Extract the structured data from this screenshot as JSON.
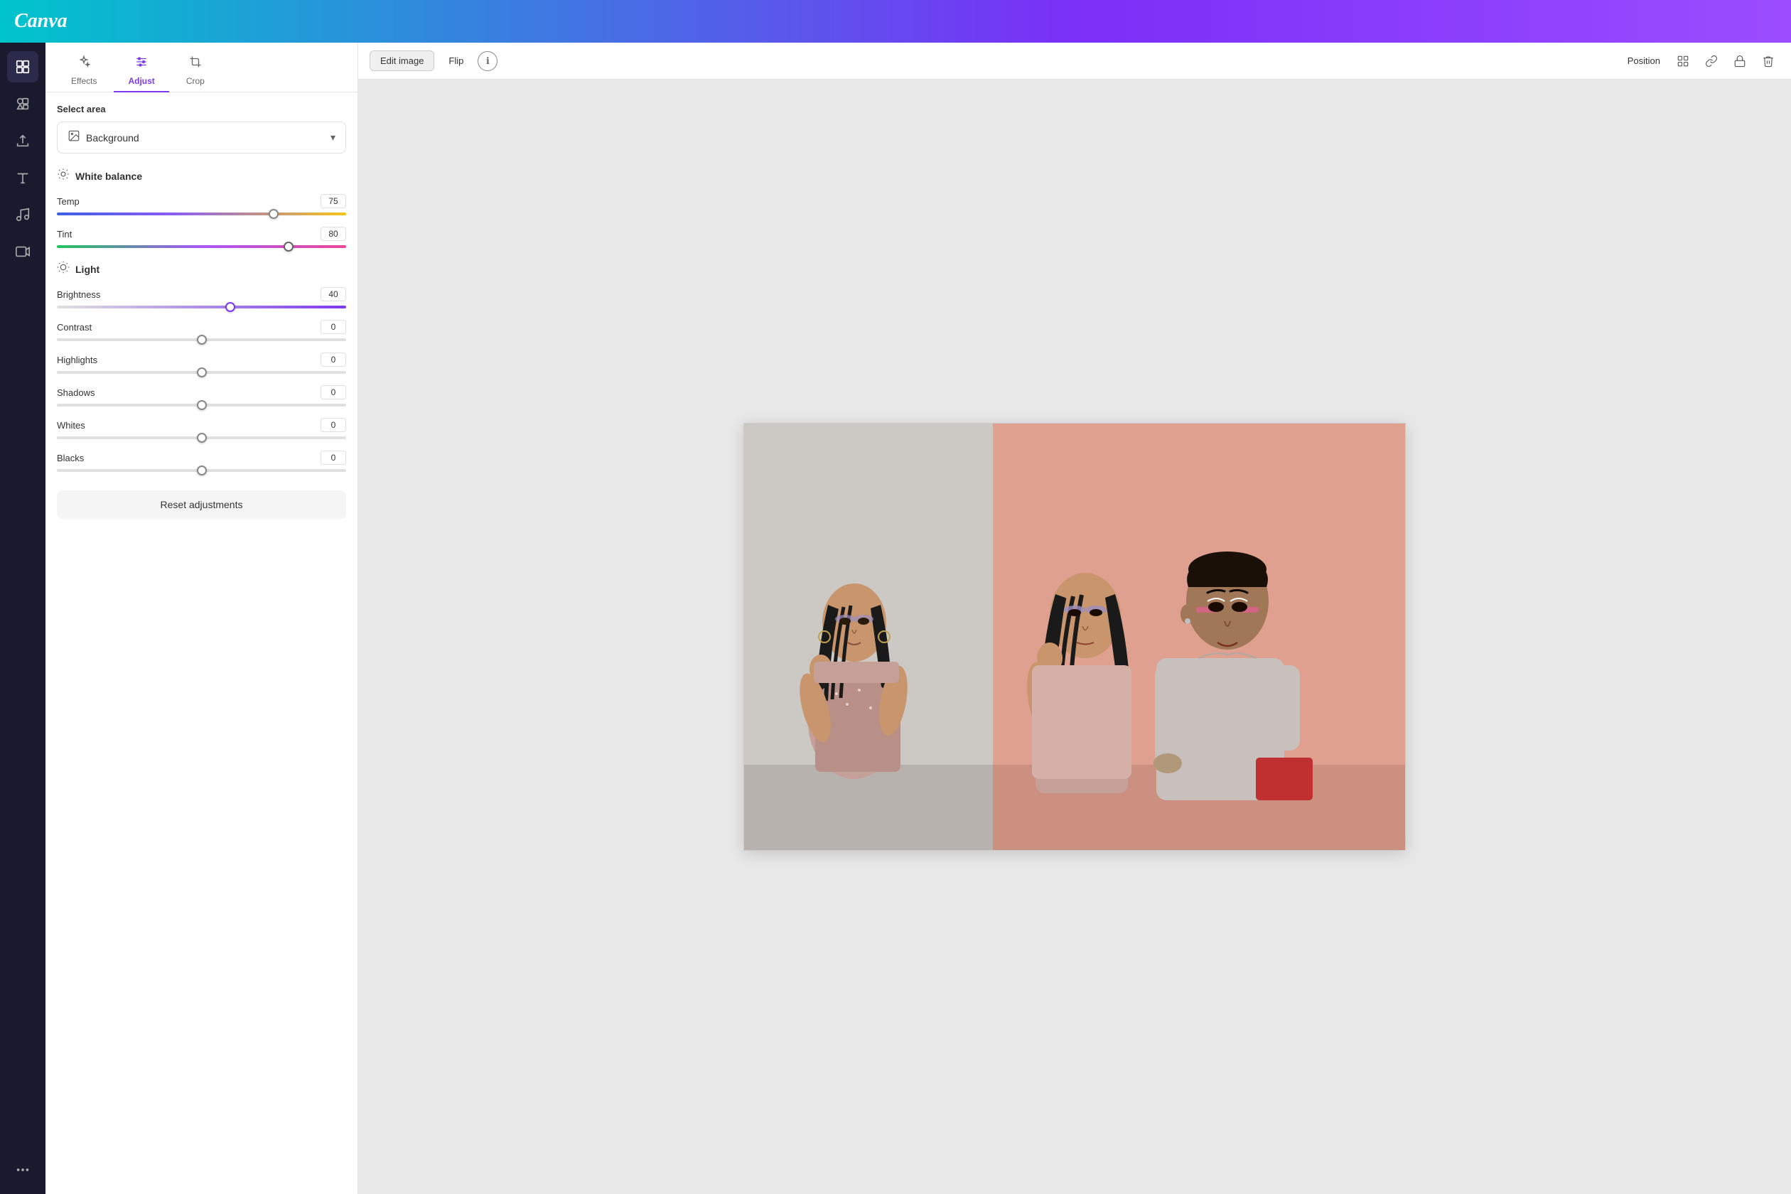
{
  "header": {
    "logo": "Canva"
  },
  "tabs": [
    {
      "id": "effects",
      "label": "Effects",
      "icon": "✦"
    },
    {
      "id": "adjust",
      "label": "Adjust",
      "icon": "⚙"
    },
    {
      "id": "crop",
      "label": "Crop",
      "icon": "⊡"
    }
  ],
  "active_tab": "adjust",
  "select_area": {
    "label": "Select area",
    "value": "Background",
    "icon": "🖼"
  },
  "white_balance": {
    "title": "White balance",
    "icon": "💡",
    "sliders": [
      {
        "id": "temp",
        "label": "Temp",
        "value": "75",
        "percent": 75
      },
      {
        "id": "tint",
        "label": "Tint",
        "value": "80",
        "percent": 80
      }
    ]
  },
  "light": {
    "title": "Light",
    "icon": "☀",
    "sliders": [
      {
        "id": "brightness",
        "label": "Brightness",
        "value": "40",
        "percent": 60
      },
      {
        "id": "contrast",
        "label": "Contrast",
        "value": "0",
        "percent": 50
      },
      {
        "id": "highlights",
        "label": "Highlights",
        "value": "0",
        "percent": 50
      },
      {
        "id": "shadows",
        "label": "Shadows",
        "value": "0",
        "percent": 50
      },
      {
        "id": "whites",
        "label": "Whites",
        "value": "0",
        "percent": 50
      },
      {
        "id": "blacks",
        "label": "Blacks",
        "value": "0",
        "percent": 50
      }
    ]
  },
  "reset_btn": "Reset adjustments",
  "toolbar": {
    "edit_image": "Edit image",
    "flip": "Flip",
    "position": "Position",
    "info_icon": "ℹ"
  }
}
